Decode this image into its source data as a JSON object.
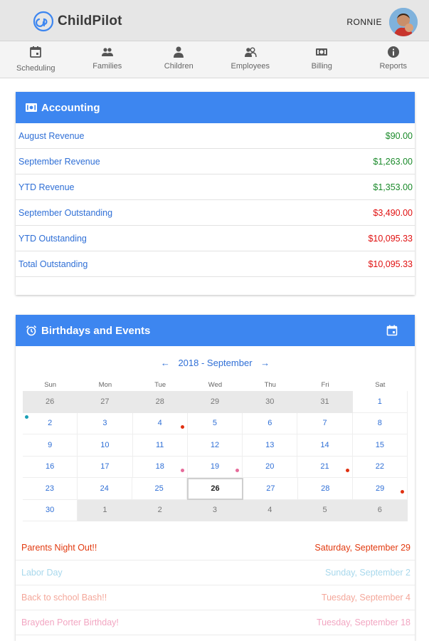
{
  "app": {
    "name": "ChildPilot"
  },
  "user": {
    "name": "RONNIE"
  },
  "nav": [
    {
      "label": "Scheduling",
      "icon": "calendar-icon"
    },
    {
      "label": "Families",
      "icon": "people-icon"
    },
    {
      "label": "Children",
      "icon": "person-icon"
    },
    {
      "label": "Employees",
      "icon": "employees-icon"
    },
    {
      "label": "Billing",
      "icon": "money-icon"
    },
    {
      "label": "Reports",
      "icon": "info-icon"
    }
  ],
  "accounting": {
    "title": "Accounting",
    "rows": [
      {
        "label": "August Revenue",
        "value": "$90.00",
        "status": "positive"
      },
      {
        "label": "September Revenue",
        "value": "$1,263.00",
        "status": "positive"
      },
      {
        "label": "YTD Revenue",
        "value": "$1,353.00",
        "status": "positive"
      },
      {
        "label": "September Outstanding",
        "value": "$3,490.00",
        "status": "negative"
      },
      {
        "label": "YTD Outstanding",
        "value": "$10,095.33",
        "status": "negative"
      },
      {
        "label": "Total Outstanding",
        "value": "$10,095.33",
        "status": "negative"
      }
    ]
  },
  "events_card": {
    "title": "Birthdays and Events",
    "month_label": "2018 - September",
    "weekdays": [
      "Sun",
      "Mon",
      "Tue",
      "Wed",
      "Thu",
      "Fri",
      "Sat"
    ],
    "weeks": [
      [
        {
          "d": "26",
          "o": true
        },
        {
          "d": "27",
          "o": true
        },
        {
          "d": "28",
          "o": true
        },
        {
          "d": "29",
          "o": true
        },
        {
          "d": "30",
          "o": true
        },
        {
          "d": "31",
          "o": true
        },
        {
          "d": "1"
        }
      ],
      [
        {
          "d": "2",
          "dot": "#1a9fb5"
        },
        {
          "d": "3"
        },
        {
          "d": "4",
          "dot": "#e03010"
        },
        {
          "d": "5"
        },
        {
          "d": "6"
        },
        {
          "d": "7"
        },
        {
          "d": "8"
        }
      ],
      [
        {
          "d": "9"
        },
        {
          "d": "10"
        },
        {
          "d": "11"
        },
        {
          "d": "12"
        },
        {
          "d": "13"
        },
        {
          "d": "14"
        },
        {
          "d": "15"
        }
      ],
      [
        {
          "d": "16"
        },
        {
          "d": "17"
        },
        {
          "d": "18",
          "dot": "#e66b9a"
        },
        {
          "d": "19",
          "dot": "#e66b9a"
        },
        {
          "d": "20"
        },
        {
          "d": "21",
          "dot": "#e03010"
        },
        {
          "d": "22"
        }
      ],
      [
        {
          "d": "23"
        },
        {
          "d": "24"
        },
        {
          "d": "25"
        },
        {
          "d": "26",
          "today": true
        },
        {
          "d": "27"
        },
        {
          "d": "28"
        },
        {
          "d": "29",
          "dot": "#e03010"
        }
      ],
      [
        {
          "d": "30"
        },
        {
          "d": "1",
          "o": true
        },
        {
          "d": "2",
          "o": true
        },
        {
          "d": "3",
          "o": true
        },
        {
          "d": "4",
          "o": true
        },
        {
          "d": "5",
          "o": true
        },
        {
          "d": "6",
          "o": true
        }
      ]
    ],
    "events": [
      {
        "name": "Parents Night Out!!",
        "date": "Saturday, September 29",
        "color": "#e23a10"
      },
      {
        "name": "Labor Day",
        "date": "Sunday, September 2",
        "color": "#a8d8ec"
      },
      {
        "name": "Back to school Bash!!",
        "date": "Tuesday, September 4",
        "color": "#f4a79a"
      },
      {
        "name": "Brayden Porter Birthday!",
        "date": "Tuesday, September 18",
        "color": "#f2a6c2"
      },
      {
        "name": "",
        "date": "",
        "color": "#f7c7d8"
      }
    ]
  },
  "colors": {
    "accent": "#3d86f0",
    "positive": "#1a8a2a",
    "negative": "#e01010",
    "link": "#2f6fd6"
  }
}
